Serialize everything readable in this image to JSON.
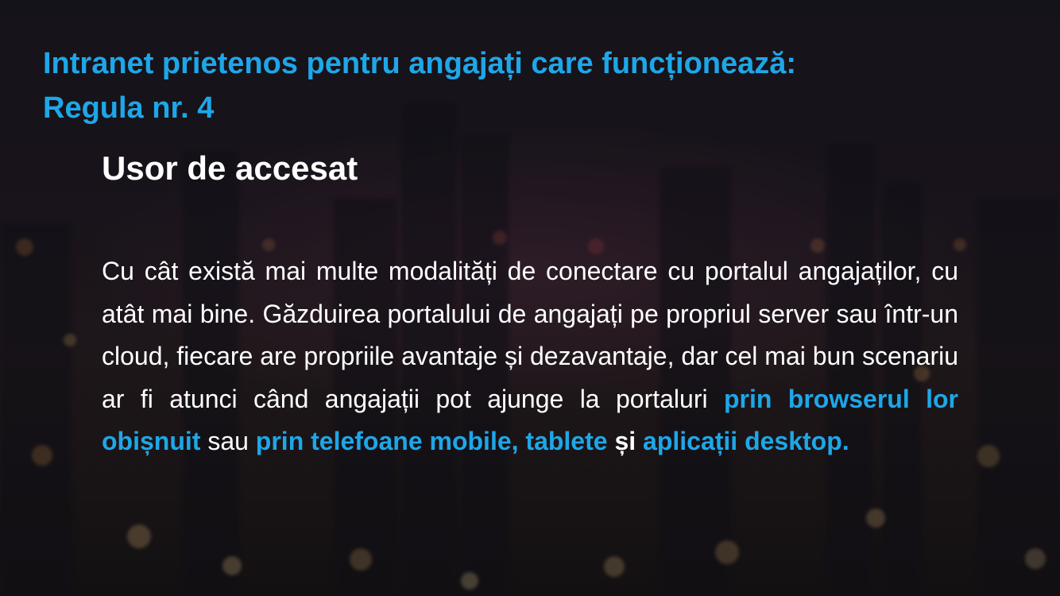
{
  "slide": {
    "title_line1": "Intranet prietenos pentru angajați care funcționează:",
    "title_line2": "Regula nr. 4",
    "subtitle": "Usor de accesat",
    "body": {
      "part1": "Cu cât există mai multe modalități de conectare cu portalul angajaților, cu atât mai bine. Găzduirea portalului  de angajați pe propriul server sau într-un cloud, fiecare are propriile avantaje și dezavantaje, dar cel mai bun scenariu ar fi atunci când angajații pot ajunge la portaluri ",
      "highlight1": "prin browserul lor obișnuit",
      "part2": " sau ",
      "highlight2": "prin telefoane mobile, tablete",
      "part3": " ",
      "bold_and": "și",
      "part4": " ",
      "highlight3": "aplicații desktop."
    }
  },
  "colors": {
    "accent": "#1ea7e8",
    "text": "#ffffff",
    "background": "#1d1a22"
  }
}
